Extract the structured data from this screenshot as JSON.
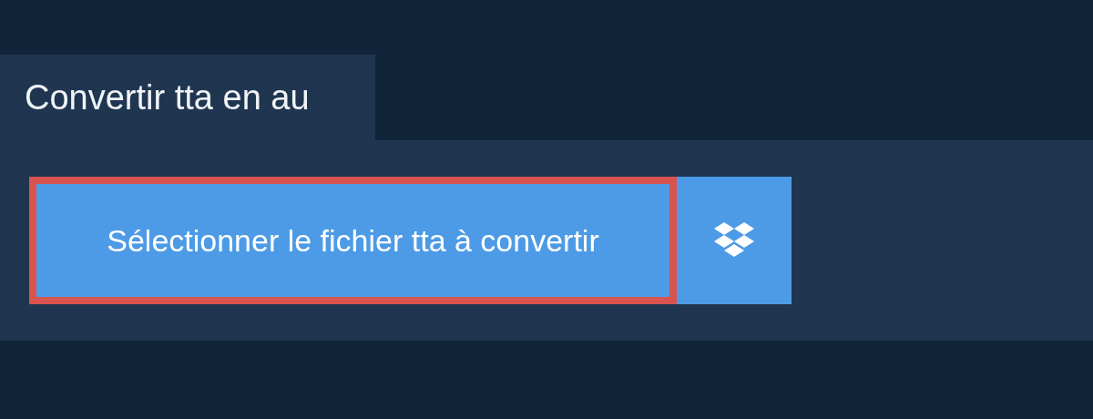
{
  "tab": {
    "title": "Convertir tta en au"
  },
  "upload": {
    "label": "Sélectionner le fichier tta à convertir",
    "highlighted": true
  }
}
